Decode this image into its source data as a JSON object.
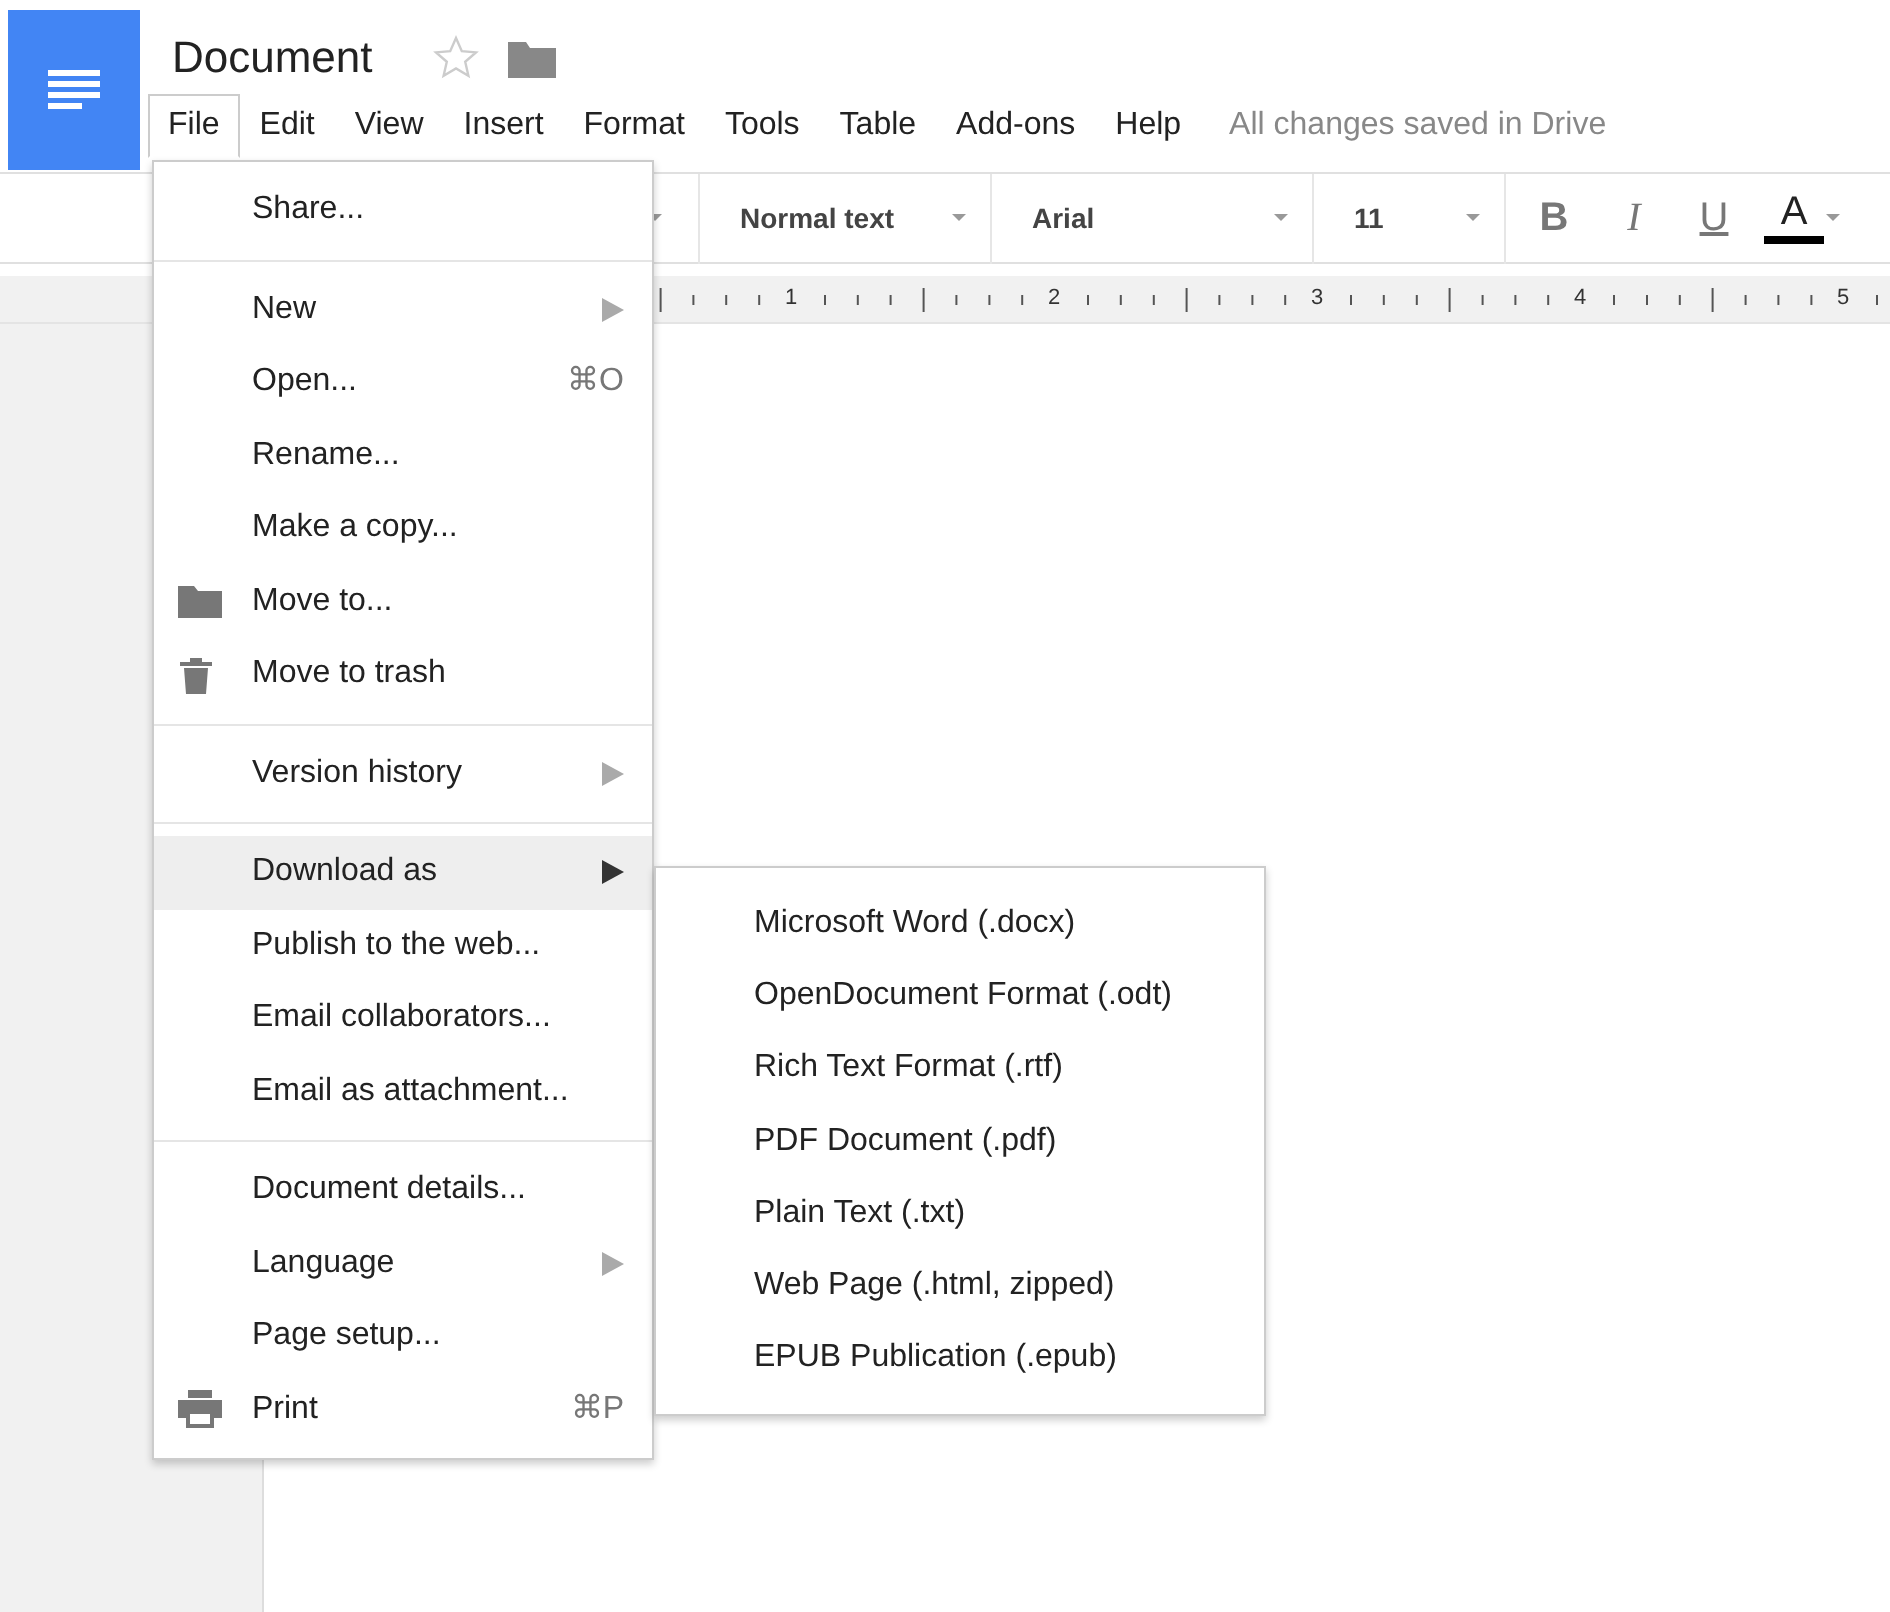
{
  "doc": {
    "title": "Document",
    "starred": false
  },
  "menubar": [
    {
      "label": "File",
      "selected": true
    },
    {
      "label": "Edit",
      "selected": false
    },
    {
      "label": "View",
      "selected": false
    },
    {
      "label": "Insert",
      "selected": false
    },
    {
      "label": "Format",
      "selected": false
    },
    {
      "label": "Tools",
      "selected": false
    },
    {
      "label": "Table",
      "selected": false
    },
    {
      "label": "Add-ons",
      "selected": false
    },
    {
      "label": "Help",
      "selected": false
    }
  ],
  "save_status": "All changes saved in Drive",
  "toolbar": {
    "style": "Normal text",
    "font": "Arial",
    "size": "11",
    "format_buttons": [
      {
        "label": "B",
        "kind": "bold"
      },
      {
        "label": "I",
        "kind": "italic"
      },
      {
        "label": "U",
        "kind": "underline"
      },
      {
        "label": "A",
        "kind": "color"
      }
    ]
  },
  "ruler": [
    "1",
    "2",
    "3",
    "4",
    "5"
  ],
  "file_menu": [
    {
      "items": [
        {
          "label": "Share...",
          "submenu": false,
          "selected": false
        }
      ]
    },
    {
      "items": [
        {
          "label": "New",
          "submenu": true,
          "selected": false
        },
        {
          "label": "Open...",
          "shortcut": "⌘O",
          "submenu": false,
          "selected": false
        },
        {
          "label": "Rename...",
          "submenu": false,
          "selected": false
        },
        {
          "label": "Make a copy...",
          "submenu": false,
          "selected": false
        },
        {
          "label": "Move to...",
          "kind": "folder",
          "submenu": false,
          "selected": false
        },
        {
          "label": "Move to trash",
          "kind": "trash",
          "submenu": false,
          "selected": false
        }
      ]
    },
    {
      "items": [
        {
          "label": "Version history",
          "submenu": true,
          "selected": false
        }
      ]
    },
    {
      "items": [
        {
          "label": "Download as",
          "submenu": true,
          "selected": true
        },
        {
          "label": "Publish to the web...",
          "submenu": false,
          "selected": false
        },
        {
          "label": "Email collaborators...",
          "submenu": false,
          "selected": false
        },
        {
          "label": "Email as attachment...",
          "submenu": false,
          "selected": false
        }
      ]
    },
    {
      "items": [
        {
          "label": "Document details...",
          "submenu": false,
          "selected": false
        },
        {
          "label": "Language",
          "submenu": true,
          "selected": false
        },
        {
          "label": "Page setup...",
          "submenu": false,
          "selected": false
        },
        {
          "label": "Print",
          "kind": "printer",
          "shortcut": "⌘P",
          "submenu": false,
          "selected": false
        }
      ]
    }
  ],
  "download_submenu": [
    "Microsoft Word (.docx)",
    "OpenDocument Format (.odt)",
    "Rich Text Format (.rtf)",
    "PDF Document (.pdf)",
    "Plain Text (.txt)",
    "Web Page (.html, zipped)",
    "EPUB Publication (.epub)"
  ]
}
